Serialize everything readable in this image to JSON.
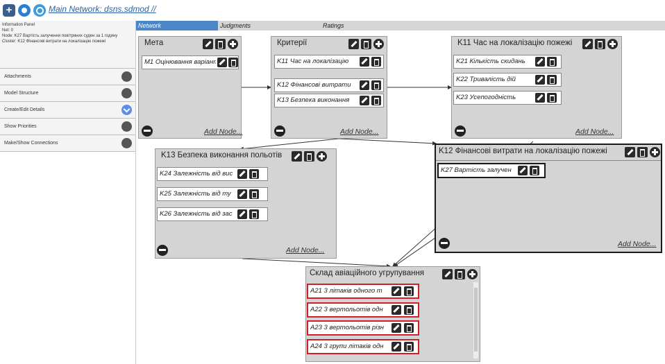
{
  "header": {
    "network_link": "Main Network: dsns.sdmod //"
  },
  "info_panel": {
    "title": "Information Panel",
    "lines": [
      "Net: 0",
      "Node: K27 Вартість залучення повітряних суден за 1 годину",
      "Cluster: K12 Фінансові витрати на локалізацію пожежі"
    ]
  },
  "left_panel": {
    "rows": [
      {
        "label": "Attachments",
        "button_icon": "circle-button-icon"
      },
      {
        "label": "Model Structure",
        "button_icon": "circle-button-icon"
      },
      {
        "label": "Create/Edit Details",
        "button_icon": "chevron-down-icon"
      },
      {
        "label": "Show Priorities",
        "button_icon": "circle-button-icon"
      },
      {
        "label": "Make/Show Connections",
        "button_icon": "circle-button-icon"
      }
    ]
  },
  "tabs": [
    {
      "label": "Network",
      "active": true
    },
    {
      "label": "Judgments",
      "active": false
    },
    {
      "label": "Ratings",
      "active": false
    }
  ],
  "add_node_label": "Add Node...",
  "clusters": {
    "meta": {
      "title": "Мета",
      "nodes": [
        "M1 Оцінювання варіанта"
      ]
    },
    "criteria": {
      "title": "Критерії",
      "nodes": [
        "K11 Час на локалізацію",
        "K12 Фінансові витрати",
        "K13 Безпека виконання"
      ]
    },
    "k11": {
      "title": "K11 Час на локалізацію пожежі",
      "nodes": [
        "K21 Кількість скидань",
        "K22 Тривалість дій",
        "K23 Усепогодність"
      ]
    },
    "k13": {
      "title": "K13 Безпека виконання польотів",
      "nodes": [
        "K24 Залежність від вис",
        "K25 Залежність від ту",
        "K26 Залежність від зас"
      ]
    },
    "k12": {
      "title": "K12 Фінансові витрати на локалізацію пожежі",
      "nodes": [
        "K27 Вартість залучен"
      ]
    },
    "group": {
      "title": "Склад авіаційного угрупування",
      "nodes": [
        "A21 3 літаків одного т",
        "A22 3 вертольотів одн",
        "A23 3 вертольотів різн",
        "A24 3 групи літаків одн"
      ]
    }
  },
  "colors": {
    "tab_active": "#4a86c8",
    "link": "#2a5fa8",
    "selected_node_border": "#d11e2a",
    "cluster_bg": "#d4d4d4"
  }
}
